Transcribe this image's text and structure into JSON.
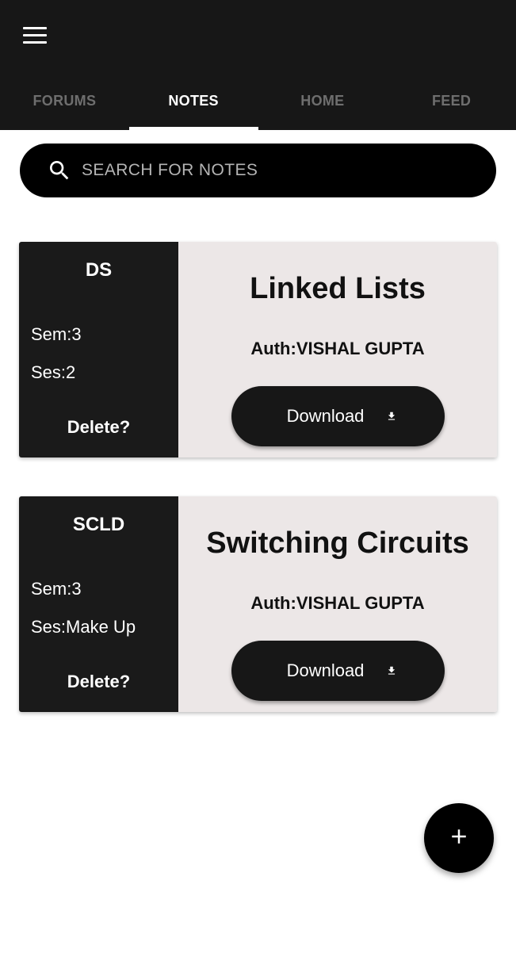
{
  "header": {
    "menu_icon": "hamburger-menu-icon",
    "tabs": [
      {
        "label": "FORUMS",
        "active": false
      },
      {
        "label": "NOTES",
        "active": true
      },
      {
        "label": "HOME",
        "active": false
      },
      {
        "label": "FEED",
        "active": false
      }
    ]
  },
  "search": {
    "placeholder": "SEARCH FOR NOTES",
    "value": "",
    "icon": "search-icon"
  },
  "notes": [
    {
      "subject": "DS",
      "sem": "Sem:3",
      "ses": "Ses:2",
      "delete_label": "Delete?",
      "title": "Linked Lists",
      "author": "Auth:VISHAL GUPTA",
      "download_label": "Download",
      "download_icon": "download-icon"
    },
    {
      "subject": "SCLD",
      "sem": "Sem:3",
      "ses": "Ses:Make Up",
      "delete_label": "Delete?",
      "title": "Switching Circuits",
      "author": "Auth:VISHAL GUPTA",
      "download_label": "Download",
      "download_icon": "download-icon"
    }
  ],
  "fab": {
    "icon": "plus-icon"
  },
  "colors": {
    "appbar": "#171717",
    "card_left": "#1a1a1a",
    "card_right": "#ece7e7",
    "tab_inactive": "#6e6e6e",
    "tab_active": "#ffffff"
  }
}
